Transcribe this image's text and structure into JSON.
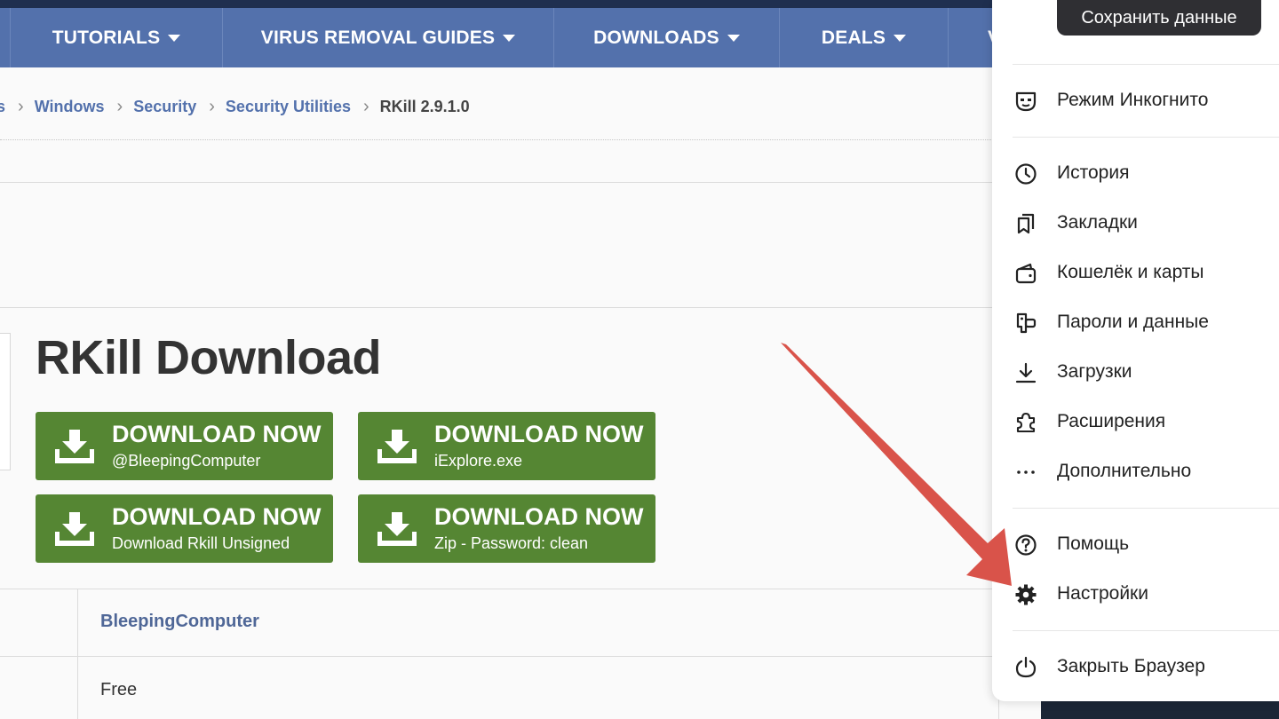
{
  "nav": {
    "items": [
      {
        "label": "TUTORIALS"
      },
      {
        "label": "VIRUS REMOVAL GUIDES"
      },
      {
        "label": "DOWNLOADS"
      },
      {
        "label": "DEALS"
      },
      {
        "label": "V"
      }
    ]
  },
  "breadcrumbs": {
    "partial": "s",
    "windows": "Windows",
    "security": "Security",
    "security_utilities": "Security Utilities",
    "current": "RKill 2.9.1.0"
  },
  "page": {
    "title": "RKill Download"
  },
  "downloads": [
    {
      "label": "DOWNLOAD NOW",
      "source": "@BleepingComputer"
    },
    {
      "label": "DOWNLOAD NOW",
      "source": "iExplore.exe"
    },
    {
      "label": "DOWNLOAD NOW",
      "source": "Download Rkill Unsigned"
    },
    {
      "label": "DOWNLOAD NOW",
      "source": "Zip - Password: clean"
    }
  ],
  "info_table": {
    "publisher": "BleepingComputer",
    "license": "Free"
  },
  "browser_menu": {
    "save_button": "Сохранить данные",
    "items": [
      {
        "label": "Режим Инкогнито",
        "icon": "incognito-icon"
      },
      {
        "label": "История",
        "icon": "clock-icon"
      },
      {
        "label": "Закладки",
        "icon": "bookmarks-icon"
      },
      {
        "label": "Кошелёк и карты",
        "icon": "wallet-icon"
      },
      {
        "label": "Пароли и данные",
        "icon": "key-icon"
      },
      {
        "label": "Загрузки",
        "icon": "download-icon"
      },
      {
        "label": "Расширения",
        "icon": "puzzle-icon"
      },
      {
        "label": "Дополнительно",
        "icon": "more-icon"
      },
      {
        "label": "Помощь",
        "icon": "help-icon"
      },
      {
        "label": "Настройки",
        "icon": "gear-icon"
      },
      {
        "label": "Закрыть Браузер",
        "icon": "power-icon"
      }
    ]
  },
  "colors": {
    "nav_bg": "#5371ac",
    "download_green": "#558633",
    "annotation_arrow": "#d9534a"
  }
}
